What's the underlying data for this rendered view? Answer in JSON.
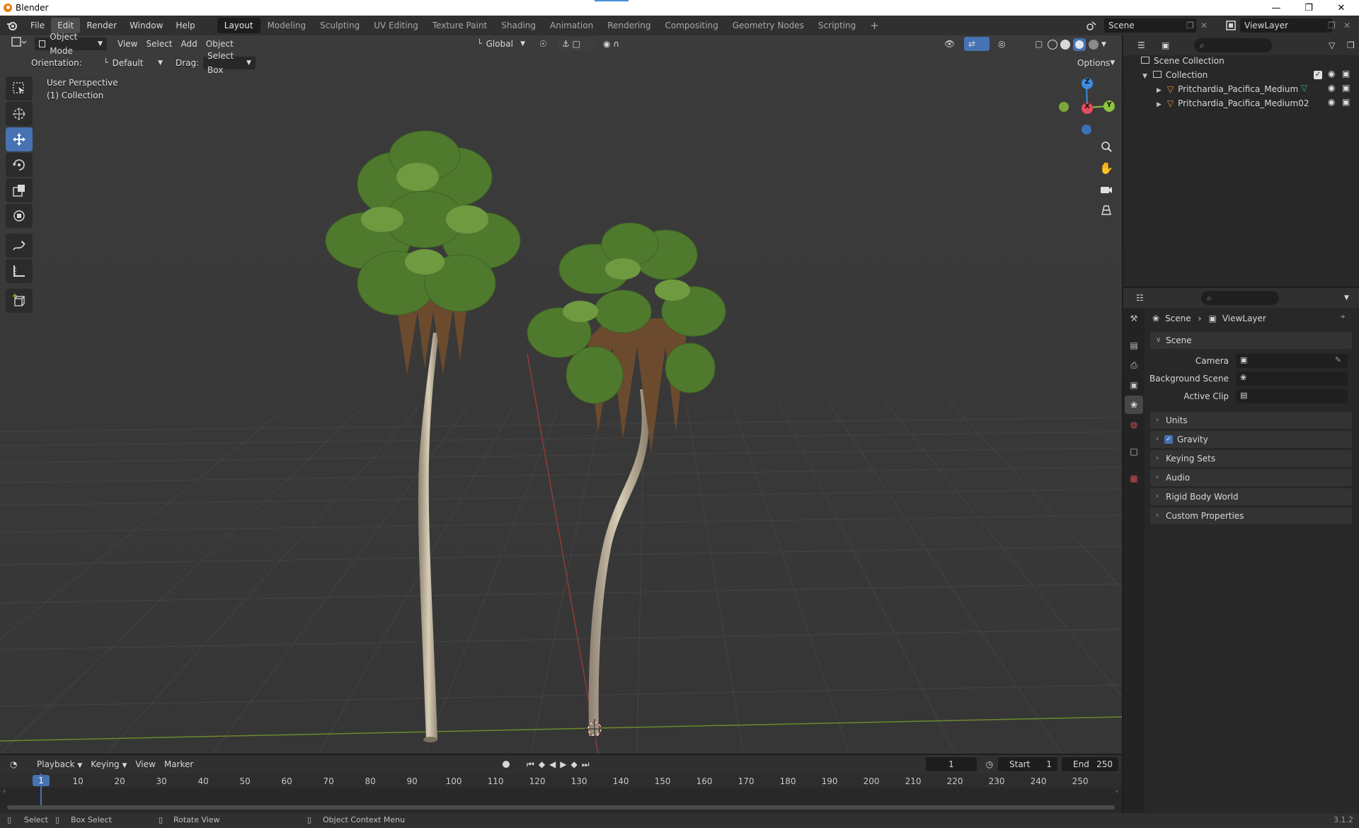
{
  "window": {
    "title": "Blender",
    "min_icon": "minimize-icon",
    "max_icon": "restore-icon",
    "close_icon": "close-icon"
  },
  "menubar": {
    "menus": [
      "File",
      "Edit",
      "Render",
      "Window",
      "Help"
    ],
    "workspaces": [
      "Layout",
      "Modeling",
      "Sculpting",
      "UV Editing",
      "Texture Paint",
      "Shading",
      "Animation",
      "Rendering",
      "Compositing",
      "Geometry Nodes",
      "Scripting"
    ],
    "add_workspace": "+",
    "scene_name": "Scene",
    "view_layer": "ViewLayer"
  },
  "viewport_header": {
    "mode": "Object Mode",
    "menus": [
      "View",
      "Select",
      "Add",
      "Object"
    ],
    "transform_orientation": "Global",
    "options_label": "Options"
  },
  "tool_settings": {
    "orientation_label": "Orientation:",
    "orientation_value": "Default",
    "drag_label": "Drag:",
    "drag_value": "Select Box"
  },
  "viewport": {
    "perspective": "User Perspective",
    "collection_info": "(1) Collection",
    "gizmo": {
      "z": "Z",
      "x": "X",
      "y": "Y"
    }
  },
  "outliner": {
    "root": "Scene Collection",
    "collection": "Collection",
    "objects": [
      "Pritchardia_Pacifica_Medium",
      "Pritchardia_Pacifica_Medium02"
    ]
  },
  "properties": {
    "breadcrumb_scene": "Scene",
    "breadcrumb_layer": "ViewLayer",
    "scene_panel": "Scene",
    "camera_label": "Camera",
    "background_scene_label": "Background Scene",
    "active_clip_label": "Active Clip",
    "panels": [
      "Units",
      "Gravity",
      "Keying Sets",
      "Audio",
      "Rigid Body World",
      "Custom Properties"
    ],
    "gravity_enabled": true
  },
  "timeline": {
    "menus": [
      "Playback",
      "Keying",
      "View",
      "Marker"
    ],
    "current_frame": "1",
    "start_label": "Start",
    "start_value": "1",
    "end_label": "End",
    "end_value": "250",
    "ruler": [
      "1",
      "10",
      "20",
      "30",
      "40",
      "50",
      "60",
      "70",
      "80",
      "90",
      "100",
      "110",
      "120",
      "130",
      "140",
      "150",
      "160",
      "170",
      "180",
      "190",
      "200",
      "210",
      "220",
      "230",
      "240",
      "250"
    ]
  },
  "statusbar": {
    "hints": [
      "Select",
      "Box Select",
      "Rotate View",
      "Object Context Menu"
    ],
    "version": "3.1.2"
  },
  "colors": {
    "accent": "#4772b3",
    "x_axis": "#e94b5e",
    "y_axis": "#8cc43d",
    "z_axis": "#3d8de0"
  }
}
